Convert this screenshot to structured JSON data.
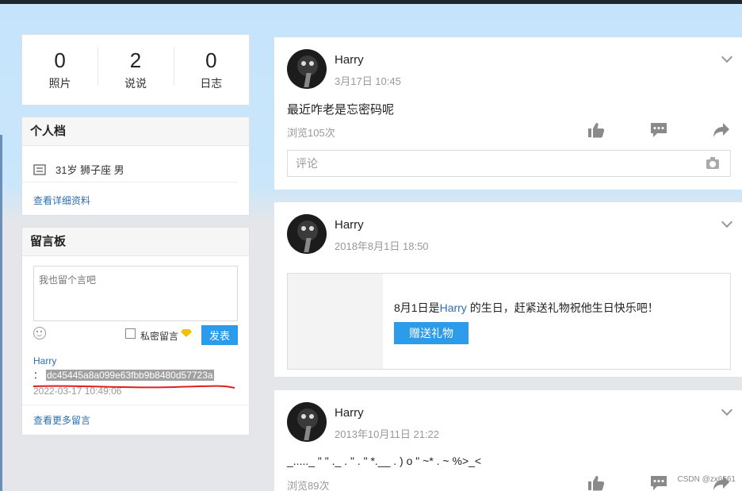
{
  "stats": [
    {
      "num": "0",
      "label": "照片"
    },
    {
      "num": "2",
      "label": "说说"
    },
    {
      "num": "0",
      "label": "日志"
    }
  ],
  "profile": {
    "title": "个人档",
    "info": "31岁  狮子座 男",
    "detail_link": "查看详细资料"
  },
  "board": {
    "title": "留言板",
    "placeholder": "我也留个言吧",
    "private_label": "私密留言",
    "post_button": "发表",
    "message": {
      "author": "Harry",
      "prefix": "：",
      "content": "dc45445a8a099e63fbb9b8480d57723a",
      "time": "2022-03-17 10:49:06"
    },
    "more_link": "查看更多留言"
  },
  "posts": [
    {
      "author": "Harry",
      "time": "3月17日 10:45",
      "text": "最近咋老是忘密码呢",
      "views": "浏览105次",
      "comment_placeholder": "评论"
    },
    {
      "author": "Harry",
      "time": "2018年8月1日 18:50",
      "bday_pre": "8月1日是",
      "bday_name": "Harry",
      "bday_post": " 的生日，赶紧送礼物祝他生日快乐吧！",
      "gift_button": "赠送礼物"
    },
    {
      "author": "Harry",
      "time": "2013年10月11日 21:22",
      "text": "_....._ \" \" ._ . \" . \" *.__ . ) o \" ~* . ~ %>_<",
      "views": "浏览89次"
    }
  ],
  "watermark": "CSDN @zx6661",
  "colors": {
    "accent": "#2b9bea",
    "link": "#2b6fb0",
    "underline": "#e02020"
  }
}
